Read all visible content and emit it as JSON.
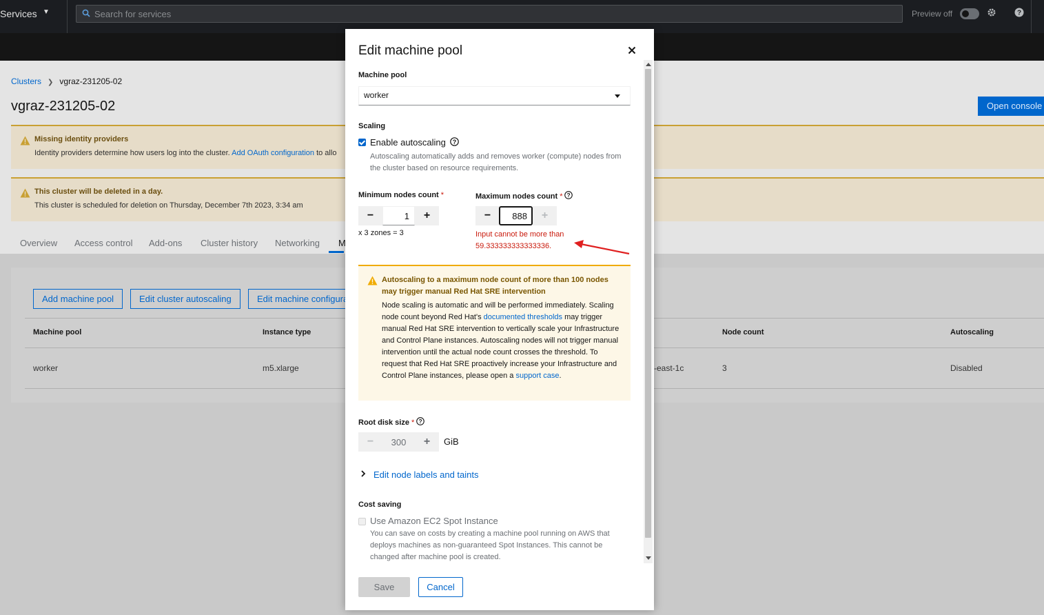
{
  "masthead": {
    "services_label": "Services",
    "search_placeholder": "Search for services",
    "preview_label": "Preview off"
  },
  "breadcrumb": {
    "root": "Clusters",
    "current": "vgraz-231205-02"
  },
  "page_title": "vgraz-231205-02",
  "open_console_label": "Open console",
  "alerts": [
    {
      "title": "Missing identity providers",
      "desc": "Identity providers determine how users log into the cluster.",
      "link": "Add OAuth configuration",
      "desc_tail": "to allo"
    },
    {
      "title": "This cluster will be deleted in a day.",
      "desc": "This cluster is scheduled for deletion on Thursday, December 7th 2023, 3:34 am"
    }
  ],
  "tabs": [
    "Overview",
    "Access control",
    "Add-ons",
    "Cluster history",
    "Networking"
  ],
  "active_tab": "M",
  "toolbar": {
    "add_pool": "Add machine pool",
    "edit_autoscaling": "Edit cluster autoscaling",
    "edit_config": "Edit machine configura"
  },
  "table": {
    "headers": [
      "Machine pool",
      "Instance type",
      "Node count",
      "Autoscaling"
    ],
    "row": {
      "pool": "worker",
      "instance": "m5.xlarge",
      "zone_fragment": "-east-1c",
      "count": "3",
      "autoscaling": "Disabled"
    }
  },
  "modal": {
    "title": "Edit machine pool",
    "machine_pool_label": "Machine pool",
    "machine_pool_value": "worker",
    "scaling_label": "Scaling",
    "enable_autoscaling_label": "Enable autoscaling",
    "autoscaling_help": "Autoscaling automatically adds and removes worker (compute) nodes from the cluster based on resource requirements.",
    "min_label": "Minimum nodes count",
    "min_value": "1",
    "zones_note": "x 3 zones = 3",
    "max_label": "Maximum nodes count",
    "max_value": "888",
    "max_error": "Input cannot be more than 59.333333333333336.",
    "warning": {
      "title": "Autoscaling to a maximum node count of more than 100 nodes may trigger manual Red Hat SRE intervention",
      "body_1": "Node scaling is automatic and will be performed immediately. Scaling node count beyond Red Hat's",
      "link_1": "documented thresholds",
      "body_2": "may trigger manual Red Hat SRE intervention to vertically scale your Infrastructure and Control Plane instances. Autoscaling nodes will not trigger manual intervention until the actual node count crosses the threshold. To request that Red Hat SRE proactively increase your Infrastructure and Control Plane instances, please open a",
      "link_2": "support case",
      "body_3": "."
    },
    "root_disk_label": "Root disk size",
    "root_disk_value": "300",
    "root_disk_unit": "GiB",
    "node_labels_link": "Edit node labels and taints",
    "cost_saving_label": "Cost saving",
    "spot_label": "Use Amazon EC2 Spot Instance",
    "spot_help": "You can save on costs by creating a machine pool running on AWS that deploys machines as non-guaranteed Spot Instances. This cannot be changed after machine pool is created.",
    "save_label": "Save",
    "cancel_label": "Cancel"
  },
  "colors": {
    "accent": "#0066cc",
    "error": "#c9190b",
    "warning": "#f0ab00"
  }
}
